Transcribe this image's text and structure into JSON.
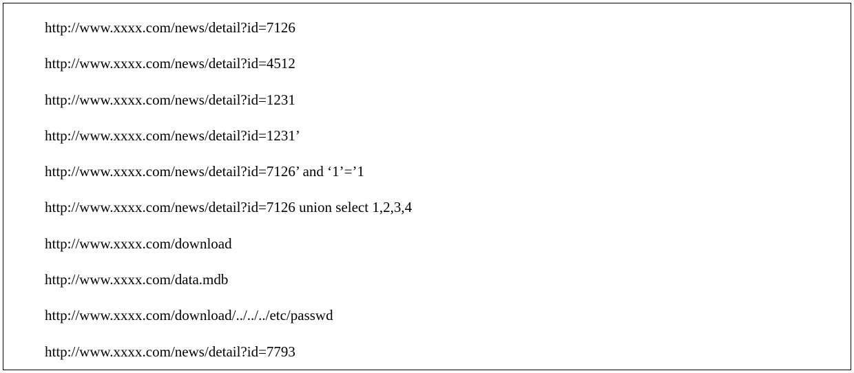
{
  "urls": [
    "http://www.xxxx.com/news/detail?id=7126",
    "http://www.xxxx.com/news/detail?id=4512",
    "http://www.xxxx.com/news/detail?id=1231",
    "http://www.xxxx.com/news/detail?id=1231’",
    "http://www.xxxx.com/news/detail?id=7126’ and ‘1’=’1",
    "http://www.xxxx.com/news/detail?id=7126 union select 1,2,3,4",
    "http://www.xxxx.com/download",
    "http://www.xxxx.com/data.mdb",
    "http://www.xxxx.com/download/../../../etc/passwd",
    "http://www.xxxx.com/news/detail?id=7793"
  ]
}
